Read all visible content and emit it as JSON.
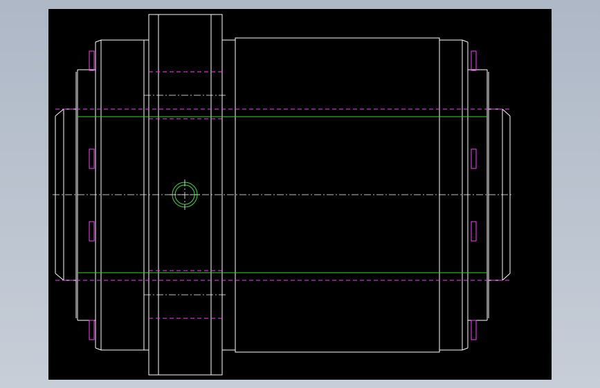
{
  "viewer": {
    "background_top": "#aeb8c6",
    "background_bottom": "#c7ced8"
  },
  "drawing": {
    "canvas_color": "#000000",
    "outline_color": "#ffffff",
    "hidden_line_color": "#ff3bff",
    "center_line_color": "#ffffff",
    "bore_line_color": "#39d939",
    "fastener_color": "#ff3bff"
  }
}
